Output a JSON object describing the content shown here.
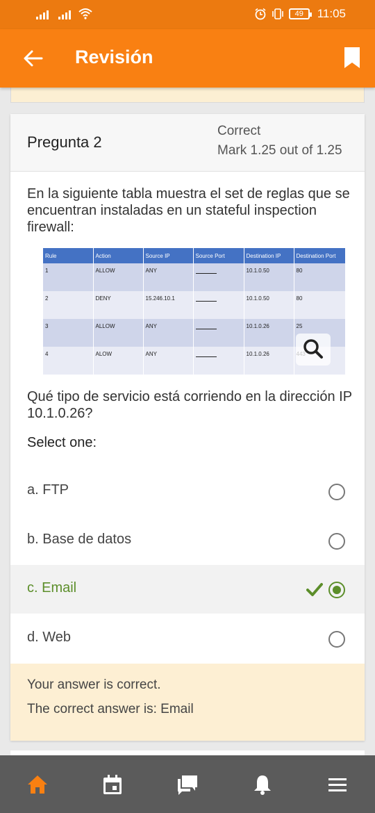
{
  "status_bar": {
    "battery": "49",
    "time": "11:05"
  },
  "app_bar": {
    "title": "Revisión",
    "back_icon": "arrow-left-icon",
    "bookmark_icon": "bookmark-icon"
  },
  "question": {
    "title": "Pregunta 2",
    "state": "Correct",
    "mark": "Mark 1.25 out of 1.25",
    "text": "En la siguiente tabla muestra el set de reglas que se encuentran instaladas en un stateful inspection firewall:",
    "table": {
      "headers": [
        "Rule",
        "Action",
        "Source IP",
        "Source Port",
        "Destination IP",
        "Destination Port"
      ],
      "rows": [
        [
          "1",
          "ALLOW",
          "ANY",
          "",
          "10.1.0.50",
          "80"
        ],
        [
          "2",
          "DENY",
          "15.246.10.1",
          "",
          "10.1.0.50",
          "80"
        ],
        [
          "3",
          "ALLOW",
          "ANY",
          "",
          "10.1.0.26",
          "25"
        ],
        [
          "4",
          "ALOW",
          "ANY",
          "",
          "10.1.0.26",
          "443"
        ]
      ]
    },
    "prompt": "Qué tipo de servicio está corriendo en la dirección IP 10.1.0.26?",
    "select_label": "Select one:",
    "options": [
      {
        "label": "a. FTP",
        "selected": false
      },
      {
        "label": "b. Base de datos",
        "selected": false
      },
      {
        "label": "c. Email",
        "selected": true
      },
      {
        "label": "d. Web",
        "selected": false
      }
    ],
    "feedback": {
      "result": "Your answer is correct.",
      "correct_answer": "The correct answer is: Email"
    }
  },
  "bottom_nav": [
    "home-icon",
    "calendar-icon",
    "messages-icon",
    "notifications-icon",
    "menu-icon"
  ],
  "colors": {
    "accent": "#f98012",
    "status_bar": "#ec7a10",
    "correct": "#5c8e2a",
    "feedback_bg": "#fdefd3",
    "nav_bg": "#5b5b5b"
  }
}
